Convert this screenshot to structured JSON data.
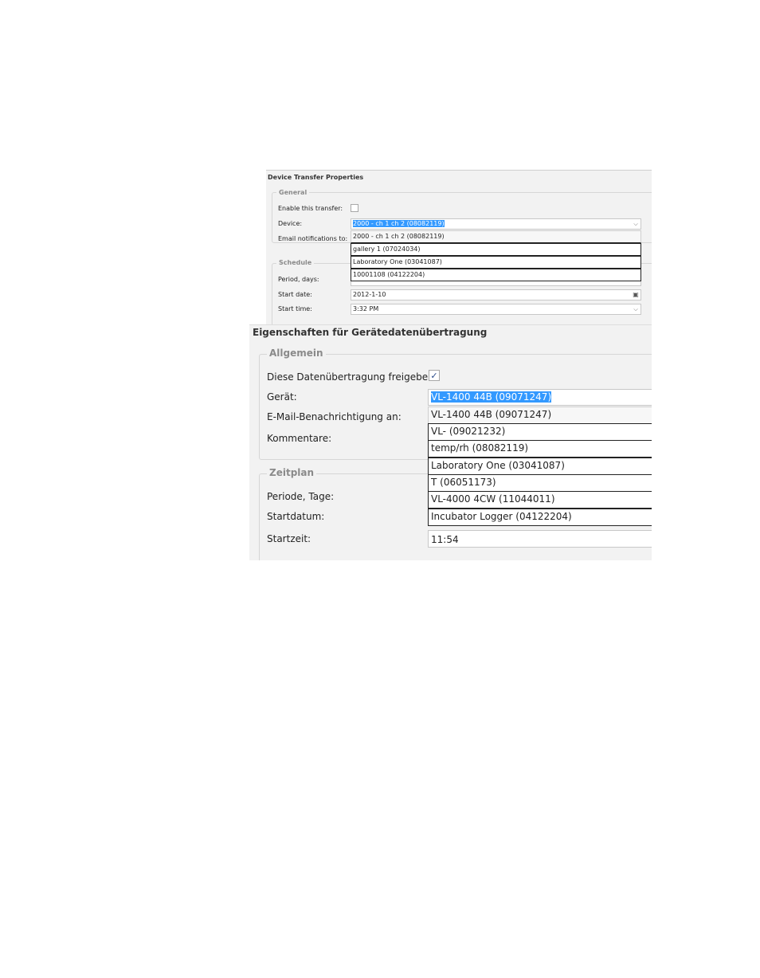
{
  "panel_en": {
    "title": "Device Transfer Properties",
    "general": {
      "legend": "General",
      "enable_label": "Enable this transfer:",
      "enable_checked": false,
      "device_label": "Device:",
      "device_value": "2000 - ch 1 ch 2 (08082119)",
      "email_label": "Email notifications to:",
      "device_options": [
        "2000 - ch 1 ch 2 (08082119)",
        "gallery 1 (07024034)",
        "Laboratory One (03041087)",
        "10001108 (04122204)"
      ]
    },
    "schedule": {
      "legend": "Schedule",
      "period_label": "Period, days:",
      "start_date_label": "Start date:",
      "start_date_value": "2012-1-10",
      "start_time_label": "Start time:",
      "start_time_value": "3:32 PM"
    }
  },
  "panel_de": {
    "title": "Eigenschaften für Gerätedatenübertragung",
    "general": {
      "legend": "Allgemein",
      "enable_label": "Diese Datenübertragung freigeben:",
      "enable_checked": true,
      "device_label": "Gerät:",
      "device_value": "VL-1400 44B (09071247)",
      "email_label": "E-Mail-Benachrichtigung an:",
      "comments_label": "Kommentare:",
      "device_options": [
        "VL-1400 44B (09071247)",
        "VL- (09021232)",
        "temp/rh (08082119)",
        "Laboratory One (03041087)",
        "T (06051173)",
        "VL-4000 4CW (11044011)",
        "Incubator Logger (04122204)"
      ]
    },
    "schedule": {
      "legend": "Zeitplan",
      "period_label": "Periode, Tage:",
      "start_date_label": "Startdatum:",
      "start_time_label": "Startzeit:",
      "start_time_value": "11:54"
    }
  },
  "icons": {
    "dropdown": "chevron-down-icon",
    "calendar": "calendar-icon",
    "check": "checkmark-icon"
  }
}
